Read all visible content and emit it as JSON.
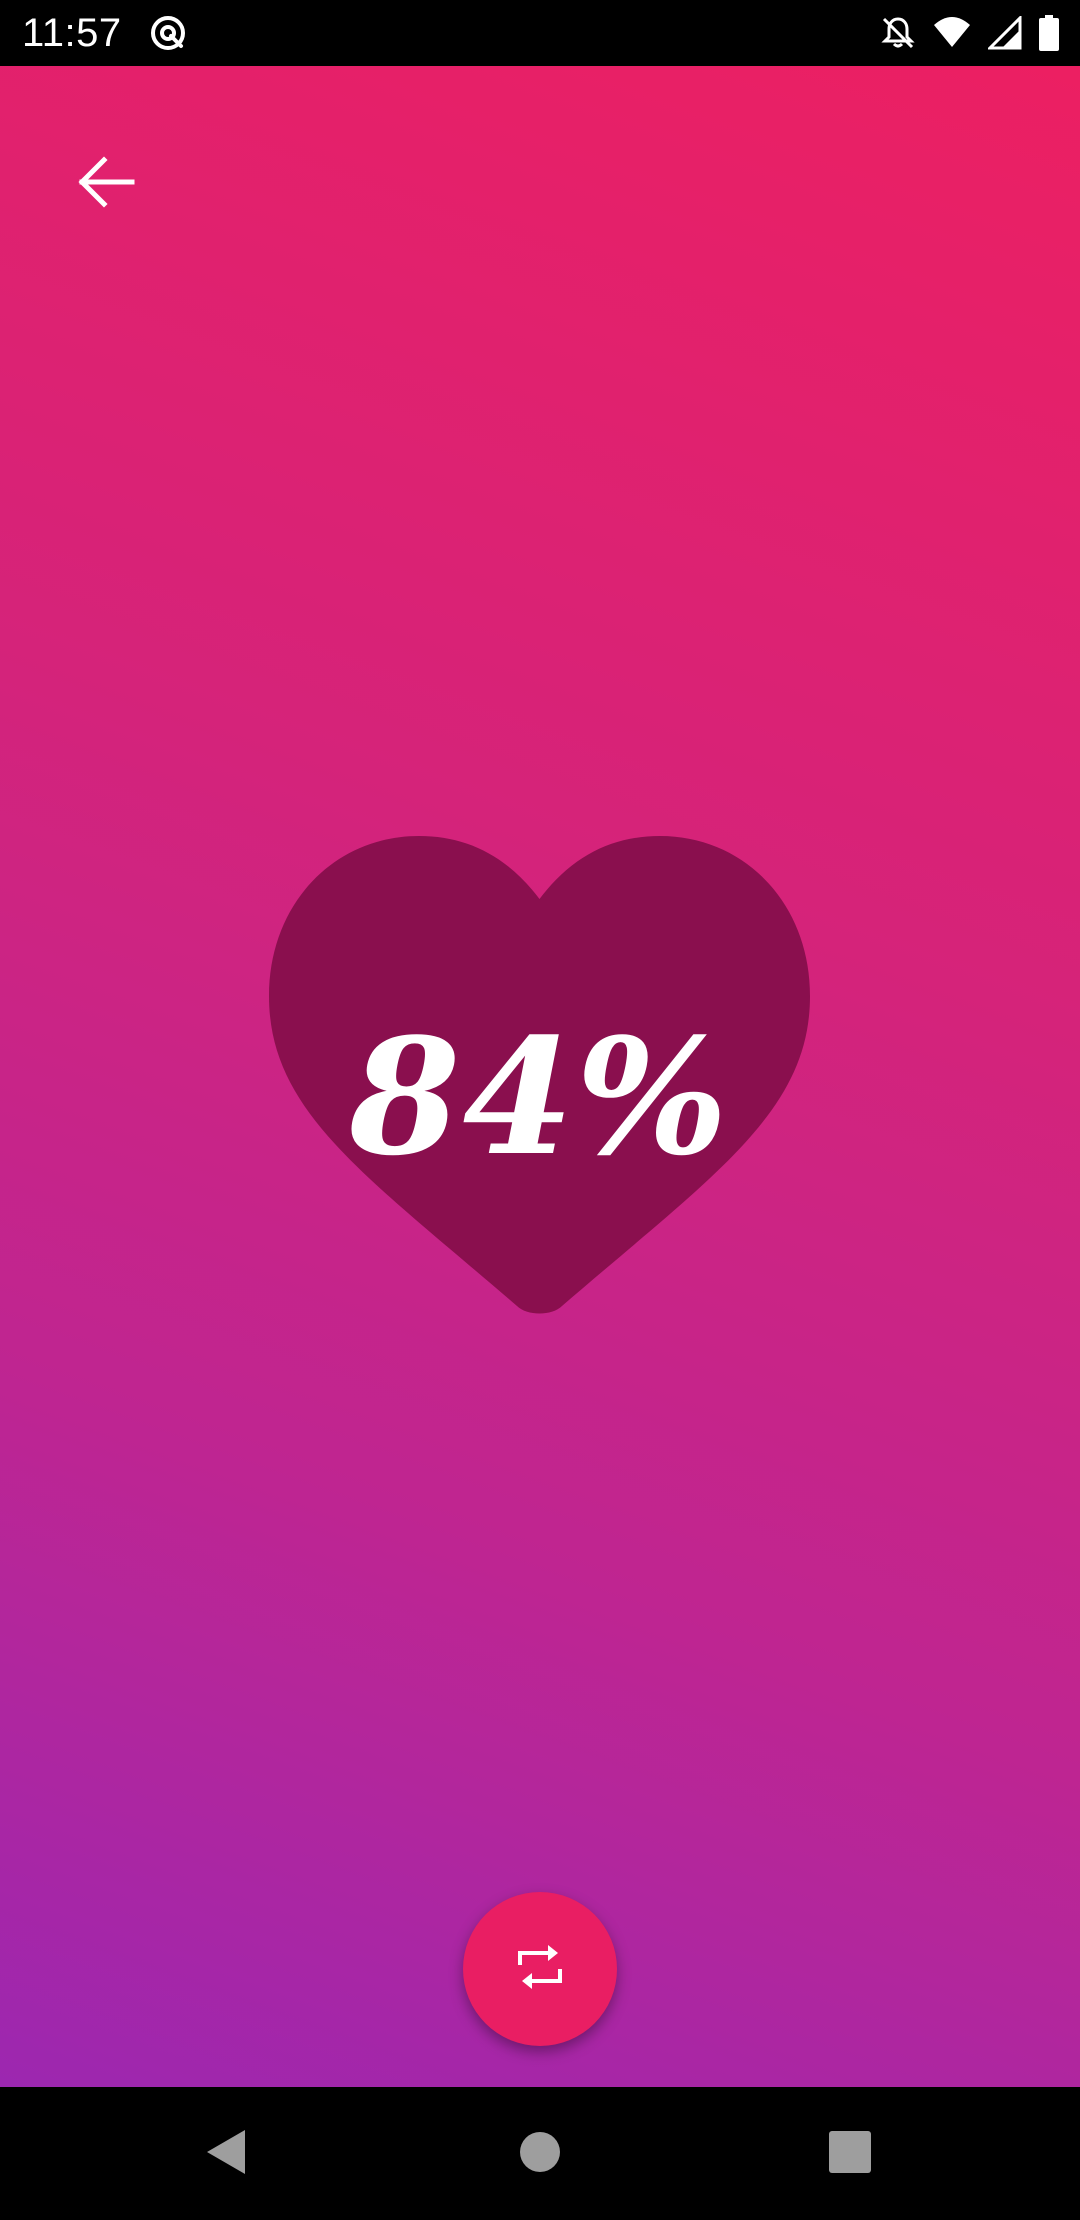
{
  "status_bar": {
    "time": "11:57",
    "icons": [
      "at-sign-icon",
      "notifications-off-icon",
      "wifi-icon",
      "cellular-signal-icon",
      "battery-icon"
    ]
  },
  "toolbar": {
    "back_icon": "arrow-back-icon"
  },
  "result": {
    "percentage": "84%"
  },
  "fab": {
    "icon": "repeat-icon"
  },
  "nav_bar": {
    "icons": [
      "nav-back-icon",
      "nav-home-icon",
      "nav-recents-icon"
    ]
  },
  "colors": {
    "gradient_top": "#ec1f62",
    "gradient_bottom": "#9c27b0",
    "heart": "#8a0f4e",
    "fab": "#e91e63",
    "text": "#ffffff"
  }
}
